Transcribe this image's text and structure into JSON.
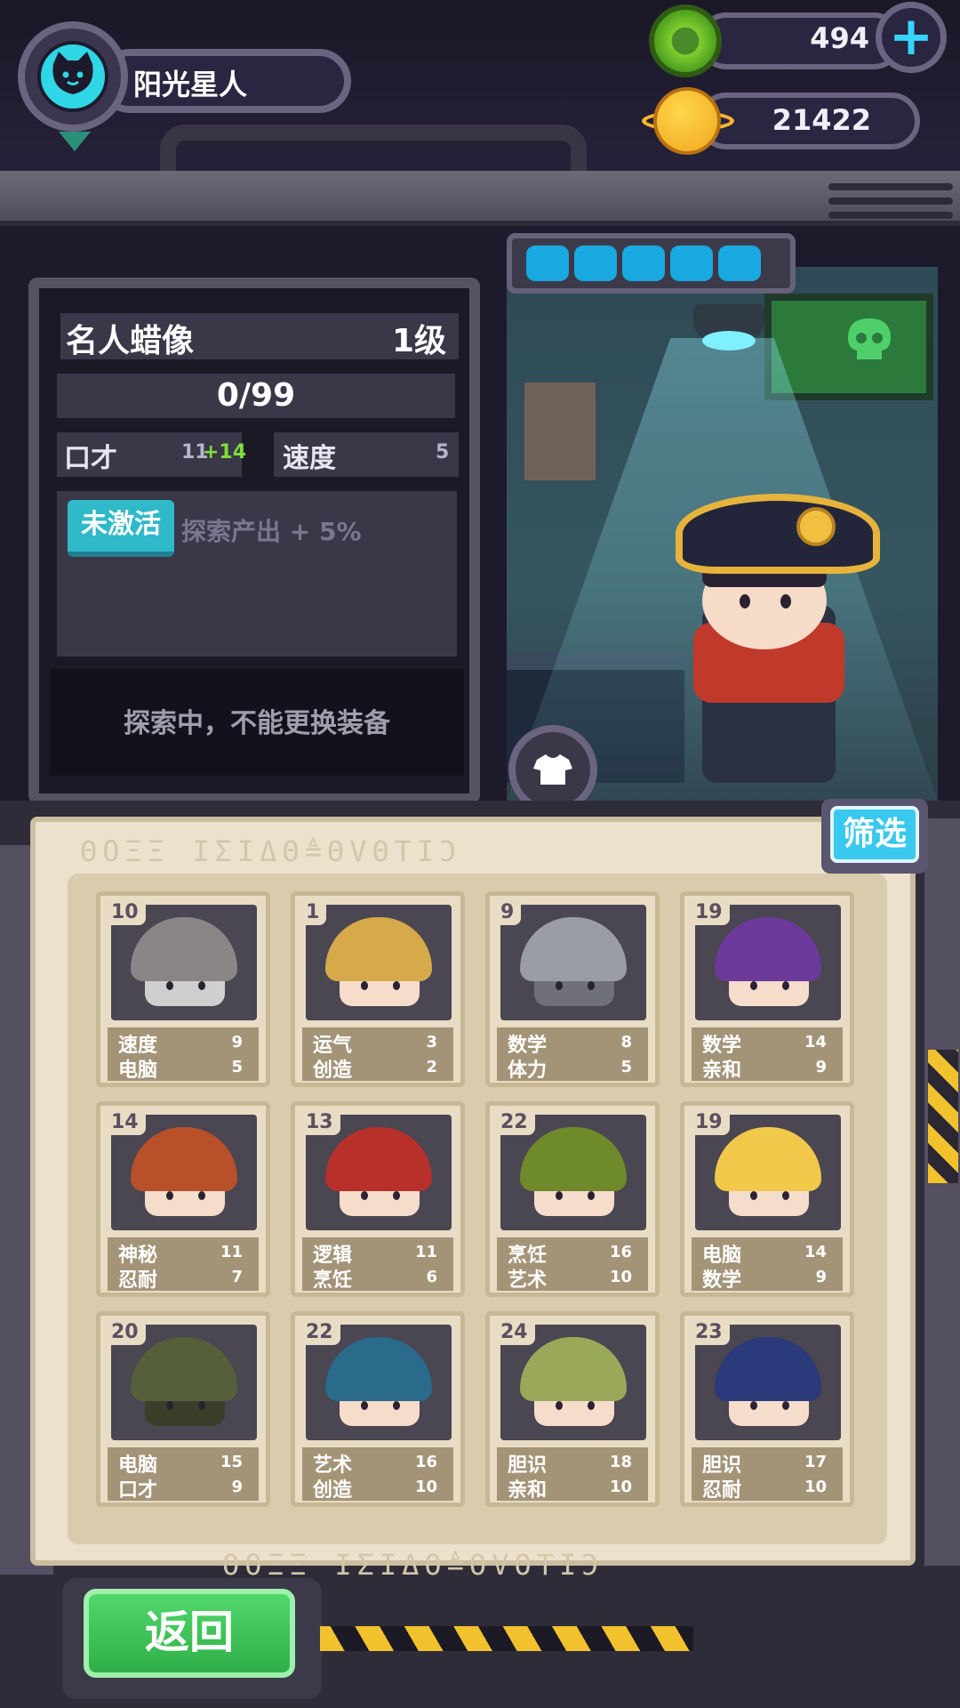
{
  "player": {
    "name": "阳光星人"
  },
  "currency": {
    "gems": "494",
    "coins": "21422"
  },
  "item": {
    "title": "名人蜡像",
    "level": "1级",
    "progress": "0/99",
    "stat1_label": "口才",
    "stat1_value": "11",
    "stat1_bonus": "+14",
    "stat2_label": "速度",
    "stat2_value": "5",
    "skill_status": "未激活",
    "skill_desc": "探索产出 + 5%",
    "notice": "探索中，不能更换装备"
  },
  "colors": {
    "accent_cyan": "#2fb9c9",
    "back_green": "#2fae48",
    "bonus_green": "#7ede3a"
  },
  "filter_label": "筛选",
  "back_label": "返回",
  "runes": "ΘՕΞΞ ΙΣΙΔΘ≜ΘVΘΤΙϽ",
  "cards": [
    {
      "num": "10",
      "s1": "速度",
      "v1": "9",
      "s2": "电脑",
      "v2": "5",
      "hat": "#8a8688",
      "face": "#cfcfcf"
    },
    {
      "num": "1",
      "s1": "运气",
      "v1": "3",
      "s2": "创造",
      "v2": "2",
      "hat": "#d6a94a",
      "face": "#f6dccb"
    },
    {
      "num": "9",
      "s1": "数学",
      "v1": "8",
      "s2": "体力",
      "v2": "5",
      "hat": "#9a9ca6",
      "face": "#6f7078"
    },
    {
      "num": "19",
      "s1": "数学",
      "v1": "14",
      "s2": "亲和",
      "v2": "9",
      "hat": "#6b3a9a",
      "face": "#f6dccb"
    },
    {
      "num": "14",
      "s1": "神秘",
      "v1": "11",
      "s2": "忍耐",
      "v2": "7",
      "hat": "#b8512a",
      "face": "#f6dccb"
    },
    {
      "num": "13",
      "s1": "逻辑",
      "v1": "11",
      "s2": "烹饪",
      "v2": "6",
      "hat": "#b8302a",
      "face": "#f6dccb"
    },
    {
      "num": "22",
      "s1": "烹饪",
      "v1": "16",
      "s2": "艺术",
      "v2": "10",
      "hat": "#6f8a2a",
      "face": "#f6dccb"
    },
    {
      "num": "19",
      "s1": "电脑",
      "v1": "14",
      "s2": "数学",
      "v2": "9",
      "hat": "#f2c84a",
      "face": "#f6dccb"
    },
    {
      "num": "20",
      "s1": "电脑",
      "v1": "15",
      "s2": "口才",
      "v2": "9",
      "hat": "#55603a",
      "face": "#3a3f2a"
    },
    {
      "num": "22",
      "s1": "艺术",
      "v1": "16",
      "s2": "创造",
      "v2": "10",
      "hat": "#2a6a8a",
      "face": "#f6dccb"
    },
    {
      "num": "24",
      "s1": "胆识",
      "v1": "18",
      "s2": "亲和",
      "v2": "10",
      "hat": "#9aa85a",
      "face": "#f6dccb"
    },
    {
      "num": "23",
      "s1": "胆识",
      "v1": "17",
      "s2": "忍耐",
      "v2": "10",
      "hat": "#2a3a7a",
      "face": "#f6dccb"
    }
  ]
}
